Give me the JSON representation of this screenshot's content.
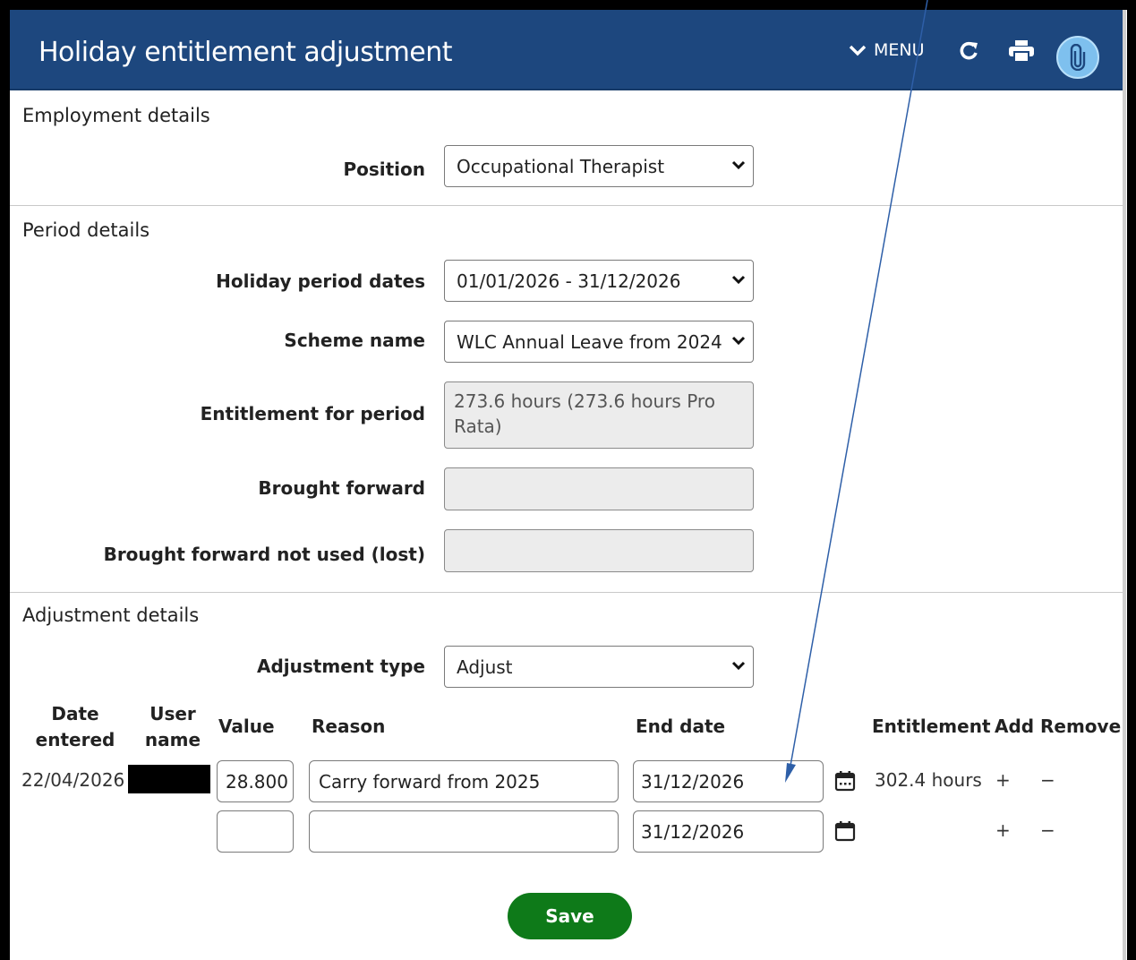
{
  "header": {
    "title": "Holiday entitlement adjustment",
    "menu_label": "MENU",
    "icons": [
      "chevron-down-icon",
      "refresh-icon",
      "print-icon",
      "paperclip-icon"
    ],
    "background_color": "#1d477e",
    "attachment_color": "#7ec0ee"
  },
  "employment": {
    "section_title": "Employment details",
    "position_label": "Position",
    "position_value": "Occupational Therapist"
  },
  "period": {
    "section_title": "Period details",
    "holiday_dates_label": "Holiday period dates",
    "holiday_dates_value": "01/01/2026 - 31/12/2026",
    "scheme_label": "Scheme name",
    "scheme_value": "WLC Annual Leave from 2024",
    "entitlement_label": "Entitlement for period",
    "entitlement_value": "273.6 hours (273.6 hours Pro Rata)",
    "brought_forward_label": "Brought forward",
    "brought_forward_value": "",
    "bf_not_used_label": "Brought forward not used (lost)",
    "bf_not_used_value": ""
  },
  "adjustment": {
    "section_title": "Adjustment details",
    "type_label": "Adjustment type",
    "type_value": "Adjust",
    "columns": {
      "date_entered_1": "Date",
      "date_entered_2": "entered",
      "user_name_1": "User",
      "user_name_2": "name",
      "value": "Value",
      "reason": "Reason",
      "end_date": "End date",
      "entitlement": "Entitlement",
      "add": "Add",
      "remove": "Remove"
    },
    "rows": [
      {
        "date_entered": "22/04/2026",
        "user_name": "",
        "value": "28.800",
        "reason": "Carry forward from 2025",
        "end_date": "31/12/2026",
        "entitlement": "302.4 hours",
        "add": "+",
        "remove": "−"
      },
      {
        "date_entered": "",
        "user_name": "",
        "value": "",
        "reason": "",
        "end_date": "31/12/2026",
        "entitlement": "",
        "add": "+",
        "remove": "−"
      }
    ]
  },
  "save_label": "Save",
  "save_color": "#0e7a19"
}
